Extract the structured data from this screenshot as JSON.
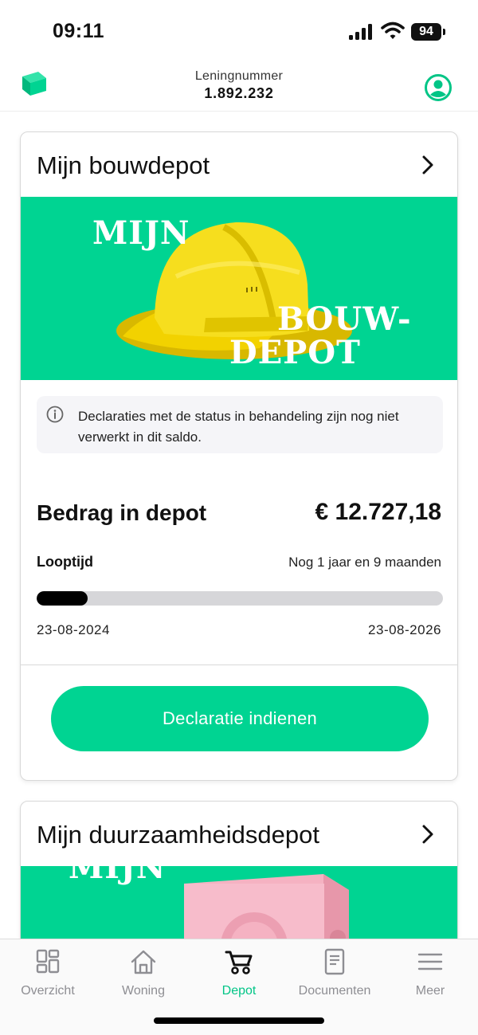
{
  "status_bar": {
    "time": "09:11",
    "battery": "94"
  },
  "header": {
    "loan_label": "Leningnummer",
    "loan_number": "1.892.232"
  },
  "bouwdepot": {
    "title": "Mijn bouwdepot",
    "banner_line1": "MIJN",
    "banner_line2": "BOUW-",
    "banner_line3": "DEPOT",
    "info_text": "Declaraties met de status in behandeling zijn nog niet verwerkt in dit saldo.",
    "amount_label": "Bedrag in depot",
    "amount_value": "€ 12.727,18",
    "term_label": "Looptijd",
    "term_value": "Nog 1 jaar en 9 maanden",
    "progress_fraction": 0.125,
    "start_date": "23-08-2024",
    "end_date": "23-08-2026",
    "button_label": "Declaratie indienen"
  },
  "duurzaamheidsdepot": {
    "title": "Mijn duurzaamheidsdepot",
    "banner_line1": "MIJN"
  },
  "nav": {
    "items": [
      {
        "label": "Overzicht",
        "icon": "grid-icon"
      },
      {
        "label": "Woning",
        "icon": "house-icon"
      },
      {
        "label": "Depot",
        "icon": "wheelbarrow-icon",
        "active": true
      },
      {
        "label": "Documenten",
        "icon": "document-icon"
      },
      {
        "label": "Meer",
        "icon": "menu-icon"
      }
    ]
  },
  "colors": {
    "accent": "#00d492",
    "accent_text": "#00c586",
    "inactive": "#8e8e93"
  }
}
